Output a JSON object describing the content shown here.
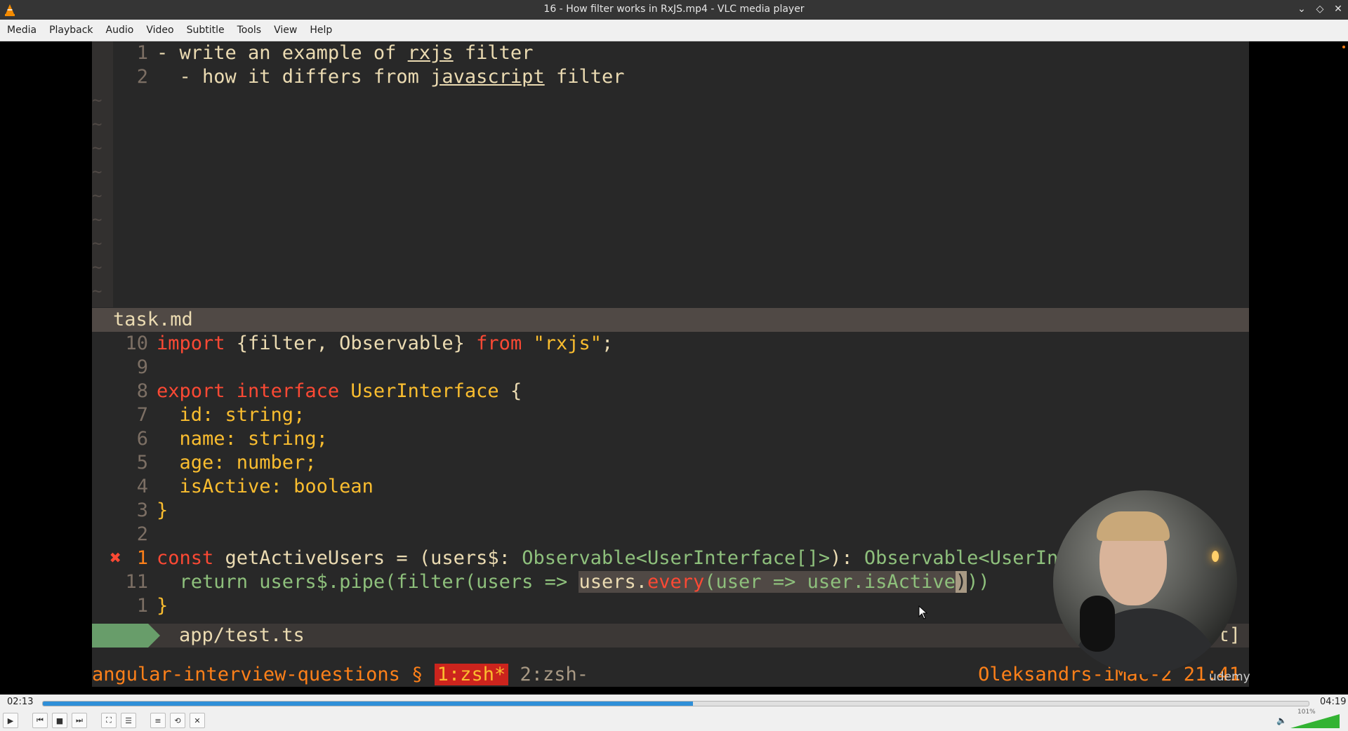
{
  "window": {
    "title": "16 - How filter works in RxJS.mp4 - VLC media player"
  },
  "menu": [
    "Media",
    "Playback",
    "Audio",
    "Video",
    "Subtitle",
    "Tools",
    "View",
    "Help"
  ],
  "editor": {
    "task": {
      "lines": [
        {
          "num": "1",
          "text_a": "- write an example of ",
          "link": "rxjs",
          "text_b": " filter"
        },
        {
          "num": "2",
          "text_a": "  - how it differs from ",
          "link": "javascript",
          "text_b": " filter"
        }
      ],
      "tildes": [
        "~",
        "~",
        "~",
        "~",
        "~",
        "~",
        "~",
        "~",
        "~"
      ],
      "statusline": "task.md"
    },
    "code": {
      "line10": {
        "num": "10",
        "kw_import": "import",
        "mid": " {filter, Observable} ",
        "kw_from": "from",
        "str": " \"rxjs\"",
        "end": ";"
      },
      "line9": {
        "num": "9"
      },
      "line8": {
        "num": "8",
        "kw_export": "export",
        "kw_interface": " interface",
        "type": " UserInterface",
        "brace": " {"
      },
      "line7": {
        "num": "7",
        "text": "  id: string;"
      },
      "line6": {
        "num": "6",
        "text": "  name: string;"
      },
      "line5": {
        "num": "5",
        "text": "  age: number;"
      },
      "line4": {
        "num": "4",
        "text": "  isActive: boolean"
      },
      "line3": {
        "num": "3",
        "text": "}"
      },
      "line2": {
        "num": "2"
      },
      "line1": {
        "num": "1",
        "err": "✖",
        "kw_const": "const",
        "mid": " getActiveUsers = (users$: ",
        "type_a": "Observable<UserInterface[]>",
        "mid2": "): ",
        "type_b": "Observable<UserInter"
      },
      "line11": {
        "num": "11",
        "a": "  return users$.pipe(filter(users => ",
        "sel_a": "users.",
        "sel_every": "every",
        "sel_b": "(user => user.isActive",
        "sel_cursor": ")",
        "b": "))"
      },
      "line1b": {
        "num": "1",
        "text": "}"
      }
    },
    "statusline_file": "app/test.ts",
    "statusline_right": "t]"
  },
  "tmux": {
    "session": "angular-interview-questions § ",
    "win_active": "1:zsh*",
    "win_other": " 2:zsh-",
    "host": "Oleksandrs-iMac-2 21:41"
  },
  "overlay": {
    "watermark": "udemy"
  },
  "player": {
    "elapsed": "02:13",
    "total": "04:19",
    "progress_percent": 51.35,
    "volume_label": "101%",
    "buttons": {
      "play": "▶",
      "prev": "⏮",
      "stop": "■",
      "next": "⏭",
      "fullscreen": "⛶",
      "extended": "☰",
      "playlist": "≡",
      "loop": "⟲",
      "shuffle": "✕"
    }
  }
}
